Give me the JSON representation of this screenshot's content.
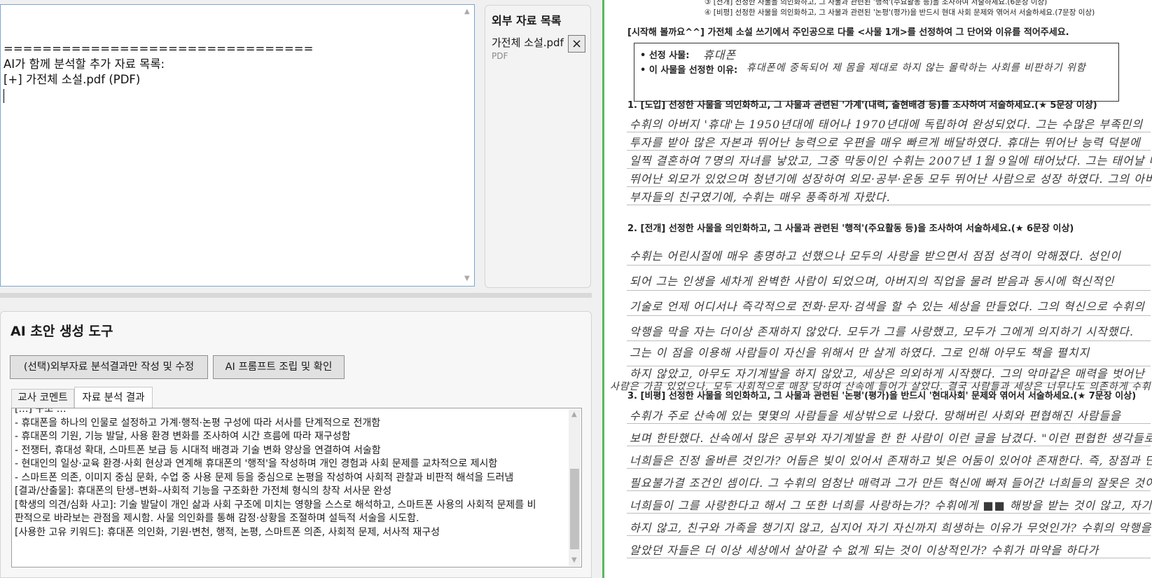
{
  "editor": {
    "lines": [
      "================================",
      "AI가 함께 분석할 추가 자료 목록:",
      "[+] 가전체 소설.pdf (PDF)"
    ]
  },
  "external_panel": {
    "title": "외부 자료 목록",
    "file_name": "가전체 소설.pdf",
    "file_type": "PDF",
    "close_label": "×"
  },
  "ai_tool": {
    "title": "AI 초안 생성 도구",
    "btn_analysis": "(선택)외부자료 분석결과만 작성 및 수정",
    "btn_prompt": "AI 프롬프트 조립 및 확인",
    "tabs": [
      "교사 코멘트",
      "자료 분석 결과"
    ],
    "active_tab": 1,
    "result_lines": [
      "[…] 구조 …",
      "- 휴대폰을 하나의 인물로 설정하고 가계·행적·논평 구성에 따라 서사를 단계적으로 전개함",
      "- 휴대폰의 기원, 기능 발달, 사용 환경 변화를 조사하여 시간 흐름에 따라 재구성함",
      "- 전쟁터, 휴대성 확대, 스마트폰 보급 등 시대적 배경과 기술 변화 양상을 연결하여 서술함",
      "- 현대인의 일상·교육 환경·사회 현상과 연계해 휴대폰의 '행적'을 작성하며 개인 경험과 사회 문제를 교차적으로 제시함",
      "- 스마트폰 의존, 이미지 중심 문화, 수업 중 사용 문제 등을 중심으로 논평을 작성하여 사회적 관찰과 비판적 해석을 드러냄",
      "[결과/산출물]: 휴대폰의 탄생–변화–사회적 기능을 구조화한 가전체 형식의 창작 서사문 완성",
      "[학생의 의견/심화 사고]: 기술 발달이 개인 삶과 사회 구조에 미치는 영향을 스스로 해석하고, 스마트폰 사용의 사회적 문제를 비판적으로 바라보는 관점을 제시함. 사물 의인화를 통해 감정·상황을 조절하며 설득적 서술을 시도함.",
      "[사용한 고유 키워드]: 휴대폰 의인화, 기원·변천, 행적, 논평, 스마트폰 의존, 사회적 문제, 서사적 재구성"
    ]
  },
  "document": {
    "top_line_1": "③ [전개] 선정한 사물을 의인화하고, 그 사물과 관련된 '행적'(주요활동 등)을 조사하여 서술하세요.(6문장 이상)",
    "top_line_2": "④ [비평] 선정한 사물을 의인화하고, 그 사물과 관련된 '논평'(평가)을 반드시 현대 사회 문제와 엮어서 서술하세요.(7문장 이상)",
    "intro": "[시작해 볼까요^^] 가전체 소설 쓰기에서 주인공으로 다룰 <사물 1개>를 선정하여 그 단어와 이유를 적어주세요.",
    "sel_item_label": "• 선정 사물:",
    "sel_item_value": "휴대폰",
    "sel_reason_label": "• 이 사물을 선정한 이유:",
    "sel_reason_value": "휴대폰에 중독되어 제 몸을 제대로 하지 않는 몰락하는 사회를 비판하기 위함",
    "q1": "1. [도입] 선정한 사물을 의인화하고, 그 사물과 관련된 '가계'(내력, 출현배경 등)를 조사하여 서술하세요.(★ 5문장 이상)",
    "q2": "2. [전개] 선정한 사물을 의인화하고, 그 사물과 관련된 '행적'(주요활동 등)을 조사하여 서술하세요.(★ 6문장 이상)",
    "q3": "3. [비평] 선정한 사물을 의인화하고, 그 사물과 관련된 '논평'(평가)을 반드시 '현대사회' 문제와 엮어서 서술하세요.(★ 7문장 이상)",
    "a1": [
      "수휘의 아버지 '휴대'는 1950년대에 태어나 1970년대에 독립하여 완성되었다. 그는 수많은 부족민의",
      "투자를 받아 많은 자본과 뛰어난 능력으로 우편을 매우 빠르게 배달하였다. 휴대는 뛰어난 능력 덕분에",
      "일찍 결혼하여 7명의 자녀를 낳았고, 그중 막둥이인 수휘는 2007년 1월 9일에 태어났다. 그는 태어날 때 부터",
      "뛰어난 외모가 있었으며 청년기에 성장하여 외모·공부·운동 모두 뛰어난 사람으로 성장 하였다. 그의 아버지가",
      "부자들의 친구였기에, 수휘는 매우 풍족하게 자랐다."
    ],
    "a2": [
      "수휘는 어린시절에 매우 총명하고 선했으나 모두의 사랑을 받으면서 점점 성격이 악해졌다. 성인이",
      "되어 그는 인생을 세차게 완벽한 사람이 되었으며, 아버지의 직업을 물려 받음과 동시에 혁신적인",
      "기술로 언제 어디서나 즉각적으로 전화·문자·검색을 할 수 있는 세상을 만들었다. 그의 혁신으로 수휘의",
      "악행을 막을 자는 더이상 존재하지 않았다. 모두가 그를 사랑했고, 모두가 그에게 의지하기 시작했다.",
      "그는 이 점을 이용해 사람들이 자신을 위해서 만 살게 하였다. 그로 인해 아무도 책을 펼치지",
      "하지 않았고, 아무도 자기계발을 하지 않았고, 세상은 의외하게 시작했다. 그의 악마같은 매력을 벗어난",
      "사람은 가끔 있었으나, 모두 사회적으로 매장 당하여 산속에 들어가 살았다. 결국 사람들과 세상은 너무나도 의존하게 수휘를"
    ],
    "a3": [
      "수휘가 주로 산속에 있는 몇몇의 사람들을 세상밖으로 나왔다. 망해버린 사회와 편협해진 사람들을",
      "보며 한탄했다. 산속에서 많은 공부와 자기계발을 한 한 사람이 이런 글을 남겼다. \"이런 편협한 생각들로",
      "너희들은 진정 올바른 것인가? 어둡은 빛이 있어서 존재하고 빛은 어둠이 있어야 존재한다. 즉, 장점과 단점은",
      "필요불가결 조건인 셈이다. 그 수휘의 엄청난 매력과 그가 만든 혁신에 빠져 들어간 너희들의 잘못은 것이다.",
      "너희들이 그를 사랑한다고 해서 그 또한 너희를 사랑하는가? 수휘에게 ■■ 해방을 받는 것이 않고, 자기 개발을",
      "하지 않고, 친구와 가족을 챙기지 않고, 심지어 자기 자신까지 희생하는 이유가 무엇인가? 수휘의 악행을",
      "알았던 자들은 더 이상 세상에서 살아갈 수 없게 되는 것이 이상적인가? 수휘가 마약을 하다가"
    ]
  }
}
